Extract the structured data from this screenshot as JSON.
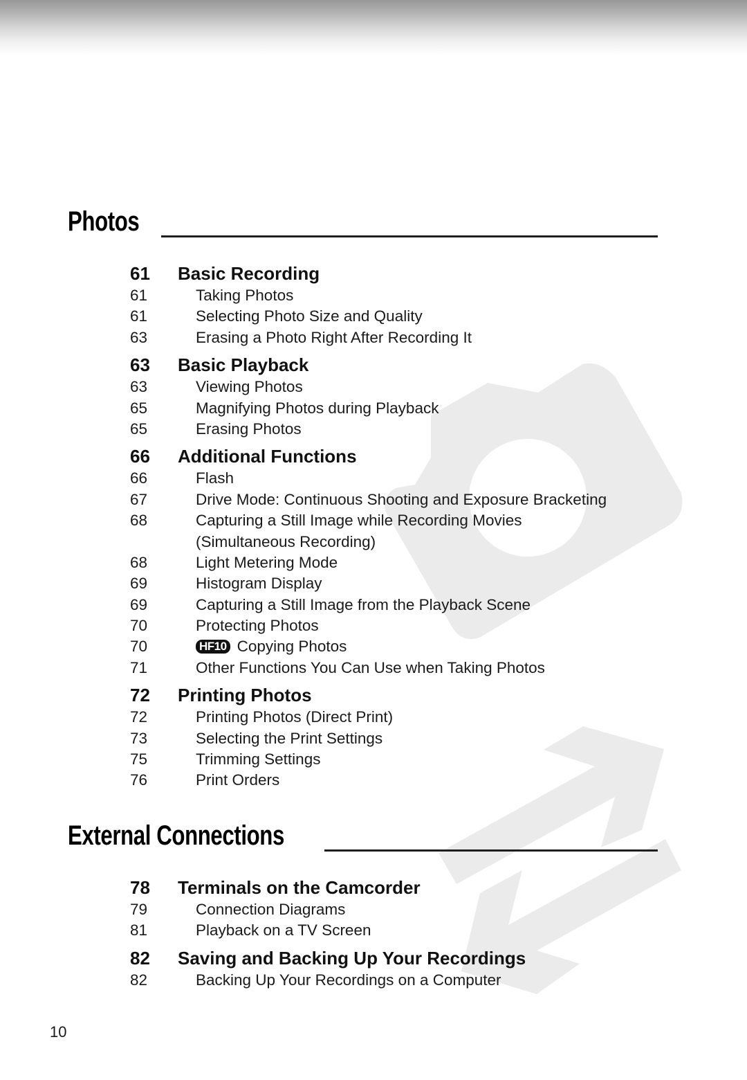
{
  "page": {
    "number": "10"
  },
  "colors": {
    "watermark": "#ebebeb",
    "text": "#1a1a1a",
    "rule": "#1e1e1e"
  },
  "sections": [
    {
      "title": "Photos",
      "watermark_icon": "camera-icon",
      "groups": [
        {
          "page": "61",
          "title": "Basic Recording",
          "entries": [
            {
              "page": "61",
              "text": "Taking Photos"
            },
            {
              "page": "61",
              "text": "Selecting Photo Size and Quality"
            },
            {
              "page": "63",
              "text": "Erasing a Photo Right After Recording It"
            }
          ]
        },
        {
          "page": "63",
          "title": "Basic Playback",
          "entries": [
            {
              "page": "63",
              "text": "Viewing Photos"
            },
            {
              "page": "65",
              "text": "Magnifying Photos during Playback"
            },
            {
              "page": "65",
              "text": "Erasing Photos"
            }
          ]
        },
        {
          "page": "66",
          "title": "Additional Functions",
          "entries": [
            {
              "page": "66",
              "text": "Flash"
            },
            {
              "page": "67",
              "text": "Drive Mode: Continuous Shooting and Exposure Bracketing"
            },
            {
              "page": "68",
              "text": "Capturing a Still Image while Recording Movies"
            },
            {
              "page": "",
              "text": "(Simultaneous Recording)"
            },
            {
              "page": "68",
              "text": "Light Metering Mode"
            },
            {
              "page": "69",
              "text": "Histogram Display"
            },
            {
              "page": "69",
              "text": "Capturing a Still Image from the Playback Scene"
            },
            {
              "page": "70",
              "text": "Protecting Photos"
            },
            {
              "page": "70",
              "badge": "HF10",
              "text": "Copying Photos"
            },
            {
              "page": "71",
              "text": "Other Functions You Can Use when Taking Photos"
            }
          ]
        },
        {
          "page": "72",
          "title": "Printing Photos",
          "entries": [
            {
              "page": "72",
              "text": "Printing Photos (Direct Print)"
            },
            {
              "page": "73",
              "text": "Selecting the Print Settings"
            },
            {
              "page": "75",
              "text": "Trimming Settings"
            },
            {
              "page": "76",
              "text": "Print Orders"
            }
          ]
        }
      ]
    },
    {
      "title": "External Connections",
      "watermark_icon": "connection-arrows-icon",
      "groups": [
        {
          "page": "78",
          "title": "Terminals on the Camcorder",
          "entries": [
            {
              "page": "79",
              "text": "Connection Diagrams"
            },
            {
              "page": "81",
              "text": "Playback on a TV Screen"
            }
          ]
        },
        {
          "page": "82",
          "title": "Saving and Backing Up Your Recordings",
          "entries": [
            {
              "page": "82",
              "text": "Backing Up Your Recordings on a Computer"
            }
          ]
        }
      ]
    }
  ]
}
